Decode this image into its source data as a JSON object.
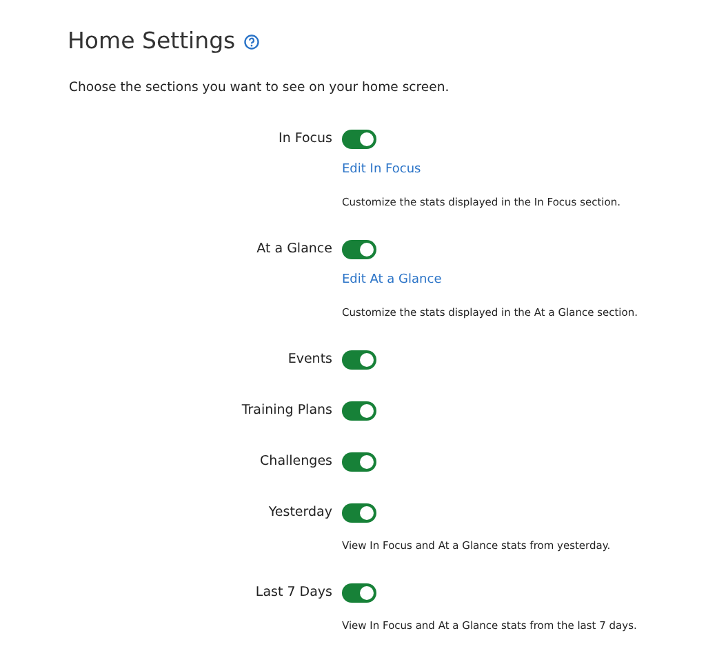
{
  "page": {
    "title": "Home Settings",
    "intro": "Choose the sections you want to see on your home screen."
  },
  "sections": [
    {
      "label": "In Focus",
      "on": true,
      "link": "Edit In Focus",
      "description": "Customize the stats displayed in the In Focus section."
    },
    {
      "label": "At a Glance",
      "on": true,
      "link": "Edit At a Glance",
      "description": "Customize the stats displayed in the At a Glance section."
    },
    {
      "label": "Events",
      "on": true
    },
    {
      "label": "Training Plans",
      "on": true
    },
    {
      "label": "Challenges",
      "on": true
    },
    {
      "label": "Yesterday",
      "on": true,
      "description": "View In Focus and At a Glance stats from yesterday."
    },
    {
      "label": "Last 7 Days",
      "on": true,
      "description": "View In Focus and At a Glance stats from the last 7 days."
    }
  ]
}
